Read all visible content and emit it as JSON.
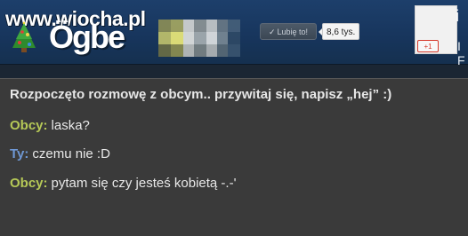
{
  "header": {
    "site_logo": "www.wiocha.pl",
    "brand_text": "Ögbe",
    "like_button_label": "Lubię to!",
    "like_count": "8,6 tys.",
    "gplus_label": "+1",
    "right_letter_top": "i",
    "right_letter_bottom": "I F"
  },
  "chat": {
    "notice": "Rozpoczęto rozmowę z obcym.. przywitaj się, napisz „hej” :)",
    "messages": [
      {
        "speaker": "Obcy:",
        "text": "laska?"
      },
      {
        "speaker": "Ty:",
        "text": "czemu nie :D"
      },
      {
        "speaker": "Obcy:",
        "text": "pytam się czy jesteś kobietą -.-'"
      }
    ]
  },
  "colors": {
    "stranger": "#b6c957",
    "you": "#6f98d5",
    "chat_background": "#3a3a3a",
    "header_background": "#1d3f6b"
  }
}
